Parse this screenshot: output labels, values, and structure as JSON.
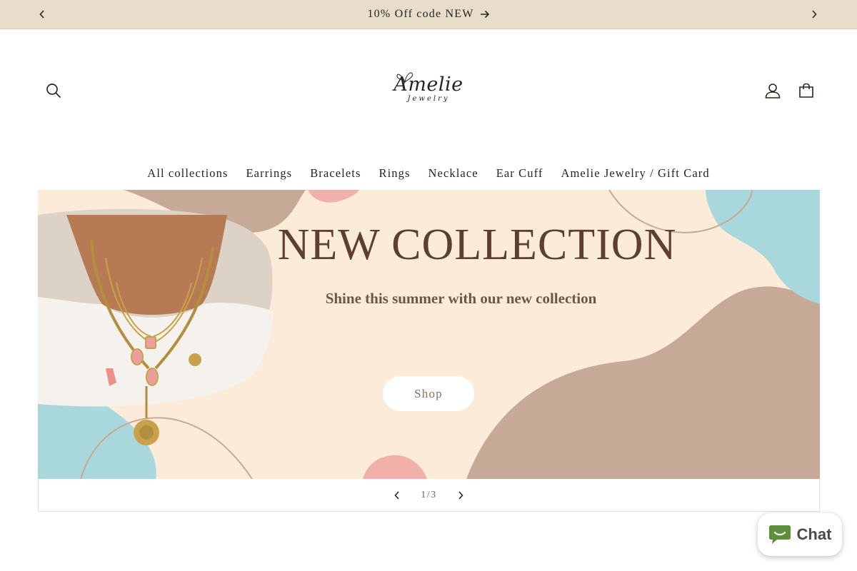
{
  "announcement": {
    "text": "10% Off code NEW",
    "icons": {
      "prev": "chevron-left-icon",
      "next": "chevron-right-icon",
      "arrow": "arrow-right-icon"
    }
  },
  "header": {
    "logo": {
      "main": "Amelie",
      "sub": "Jewelry"
    },
    "icons": {
      "search": "search-icon",
      "account": "user-icon",
      "cart": "bag-icon"
    }
  },
  "nav": {
    "items": [
      {
        "label": "All collections"
      },
      {
        "label": "Earrings"
      },
      {
        "label": "Bracelets"
      },
      {
        "label": "Rings"
      },
      {
        "label": "Necklace"
      },
      {
        "label": "Ear Cuff"
      },
      {
        "label": "Amelie Jewelry / Gift Card"
      }
    ]
  },
  "hero": {
    "title": "NEW COLLECTION",
    "subtitle": "Shine this summer with our new collection",
    "button_label": "Shop"
  },
  "slider": {
    "counter": "1/3",
    "icons": {
      "prev": "chevron-left-icon",
      "next": "chevron-right-icon"
    }
  },
  "chat": {
    "label": "Chat",
    "icon": "chat-bubble-icon"
  },
  "colors": {
    "announcement_bg": "#e8dccb",
    "hero_bg": "#fdebd9",
    "hero_title": "#5c3f2e",
    "blob_tan": "#c6a996",
    "blob_blue": "#a9d8dc",
    "blob_pink": "#f1b1aa",
    "chat_icon": "#5e8e3e"
  }
}
